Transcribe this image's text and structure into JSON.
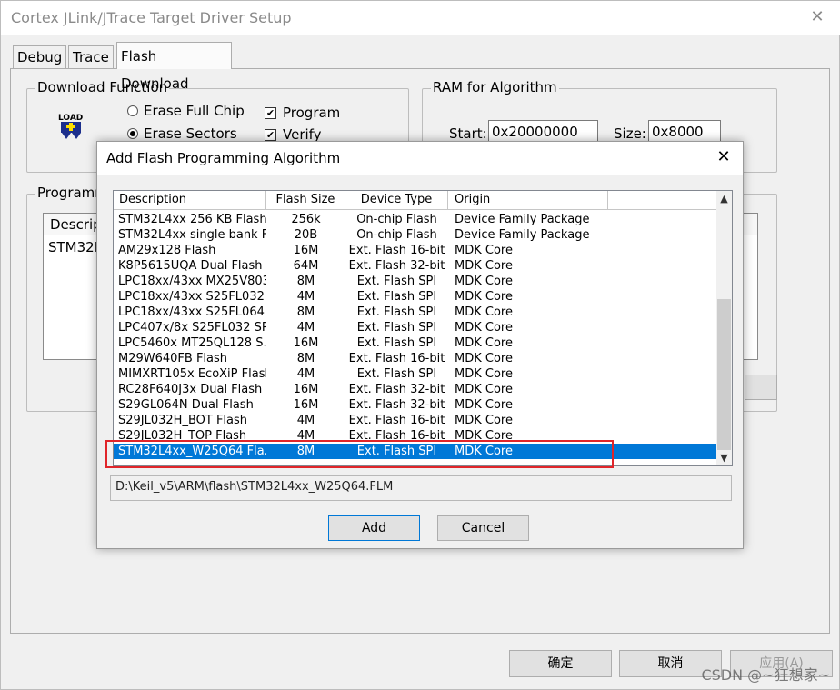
{
  "window": {
    "title": "Cortex JLink/JTrace Target Driver Setup",
    "close_glyph": "✕",
    "tabs": [
      {
        "label": "Debug"
      },
      {
        "label": "Trace"
      },
      {
        "label": "Flash Download"
      }
    ]
  },
  "download_function": {
    "group_label": "Download Function",
    "icon_text": "LOAD",
    "erase_full_chip": "Erase Full Chip",
    "erase_sectors": "Erase Sectors",
    "program": "Program",
    "verify": "Verify",
    "selected_erase": "Erase Sectors",
    "program_checked": true,
    "verify_checked": true
  },
  "ram": {
    "group_label": "RAM for Algorithm",
    "start_label": "Start:",
    "start_value": "0x20000000",
    "size_label": "Size:",
    "size_value": "0x8000"
  },
  "programming": {
    "group_label": "Programm",
    "header_partial": "Descrip",
    "row_partial": "STM32L"
  },
  "footer": {
    "ok": "确定",
    "cancel": "取消",
    "apply": "应用(A)",
    "watermark": "CSDN @~狂想家~"
  },
  "dialog": {
    "title": "Add Flash Programming Algorithm",
    "close_glyph": "✕",
    "columns": {
      "description": "Description",
      "flash_size": "Flash Size",
      "device_type": "Device Type",
      "origin": "Origin"
    },
    "rows": [
      {
        "description": "STM32L4xx 256 KB Flash",
        "size": "256k",
        "type": "On-chip Flash",
        "origin": "Device Family Package"
      },
      {
        "description": "STM32L4xx single bank F...",
        "size": "20B",
        "type": "On-chip Flash",
        "origin": "Device Family Package"
      },
      {
        "description": "AM29x128 Flash",
        "size": "16M",
        "type": "Ext. Flash 16-bit",
        "origin": "MDK Core"
      },
      {
        "description": "K8P5615UQA Dual Flash",
        "size": "64M",
        "type": "Ext. Flash 32-bit",
        "origin": "MDK Core"
      },
      {
        "description": "LPC18xx/43xx MX25V803...",
        "size": "8M",
        "type": "Ext. Flash SPI",
        "origin": "MDK Core"
      },
      {
        "description": "LPC18xx/43xx S25FL032 ...",
        "size": "4M",
        "type": "Ext. Flash SPI",
        "origin": "MDK Core"
      },
      {
        "description": "LPC18xx/43xx S25FL064 ...",
        "size": "8M",
        "type": "Ext. Flash SPI",
        "origin": "MDK Core"
      },
      {
        "description": "LPC407x/8x S25FL032 SP...",
        "size": "4M",
        "type": "Ext. Flash SPI",
        "origin": "MDK Core"
      },
      {
        "description": "LPC5460x MT25QL128 S...",
        "size": "16M",
        "type": "Ext. Flash SPI",
        "origin": "MDK Core"
      },
      {
        "description": "M29W640FB Flash",
        "size": "8M",
        "type": "Ext. Flash 16-bit",
        "origin": "MDK Core"
      },
      {
        "description": "MIMXRT105x EcoXiP Flash",
        "size": "4M",
        "type": "Ext. Flash SPI",
        "origin": "MDK Core"
      },
      {
        "description": "RC28F640J3x Dual Flash",
        "size": "16M",
        "type": "Ext. Flash 32-bit",
        "origin": "MDK Core"
      },
      {
        "description": "S29GL064N Dual Flash",
        "size": "16M",
        "type": "Ext. Flash 32-bit",
        "origin": "MDK Core"
      },
      {
        "description": "S29JL032H_BOT Flash",
        "size": "4M",
        "type": "Ext. Flash 16-bit",
        "origin": "MDK Core"
      },
      {
        "description": "S29JL032H_TOP Flash",
        "size": "4M",
        "type": "Ext. Flash 16-bit",
        "origin": "MDK Core"
      },
      {
        "description": "STM32L4xx_W25Q64 Fla...",
        "size": "8M",
        "type": "Ext. Flash SPI",
        "origin": "MDK Core",
        "selected": true
      }
    ],
    "scroll_position": 1.0,
    "scroll_visible_fraction": 0.62,
    "path": "D:\\Keil_v5\\ARM\\flash\\STM32L4xx_W25Q64.FLM",
    "add": "Add",
    "cancel": "Cancel",
    "accent": "#0078d7",
    "highlight_color": "#e0252a"
  }
}
